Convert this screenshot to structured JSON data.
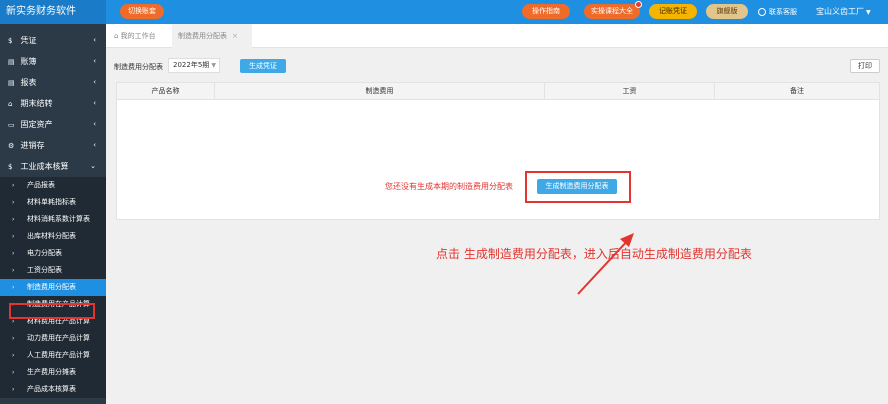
{
  "app": {
    "title": "新实务财务软件"
  },
  "topbar": {
    "switch_label": "切换账套",
    "guide_label": "操作指南",
    "course_label": "实操课程大全",
    "tickets_label": "记账凭证",
    "edition_label": "旗舰版",
    "support_label": "联系客服",
    "company_name": "宝山义齿工厂"
  },
  "sidebar": {
    "items": [
      {
        "icon": "$",
        "label": "凭证"
      },
      {
        "icon": "▤",
        "label": "账簿"
      },
      {
        "icon": "▤",
        "label": "报表"
      },
      {
        "icon": "⌂",
        "label": "期末结转"
      },
      {
        "icon": "▭",
        "label": "固定资产"
      },
      {
        "icon": "⚙",
        "label": "进销存"
      },
      {
        "icon": "$",
        "label": "工业成本核算"
      }
    ],
    "subitems": [
      "产品报表",
      "材料单耗指标表",
      "材料消耗系数计算表",
      "出库材料分配表",
      "电力分配表",
      "工资分配表",
      "制造费用分配表",
      "制造费用在产品计算",
      "材料费用在产品计算",
      "动力费用在产品计算",
      "人工费用在产品计算",
      "生产费用分摊表",
      "产品成本核算表"
    ]
  },
  "tabs": {
    "home": "我的工作台",
    "active": "制造费用分配表",
    "close": "×"
  },
  "filter": {
    "label": "制造费用分配表",
    "period": "2022年5期",
    "generate_voucher": "生成凭证",
    "print": "打印"
  },
  "table": {
    "columns": [
      "产品名称",
      "制造费用",
      "工资",
      "备注"
    ],
    "empty_message": "您还没有生成本期的制造费用分配表",
    "generate_button": "生成制造费用分配表"
  },
  "annotation": {
    "instruction": "点击 生成制造费用分配表，进入后自动生成制造费用分配表",
    "color": "#e3342f"
  }
}
